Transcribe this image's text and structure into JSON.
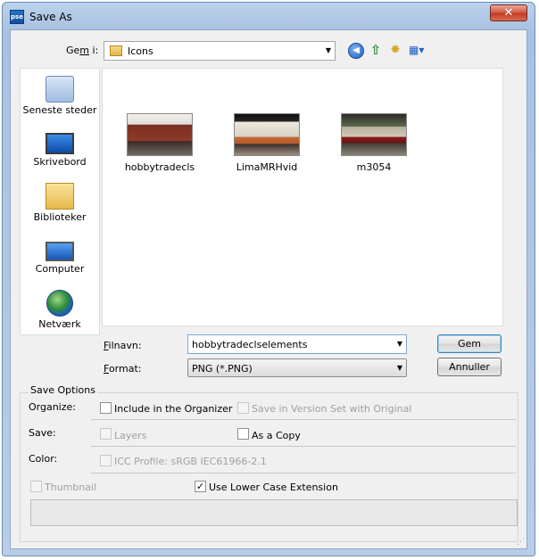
{
  "window": {
    "title": "Save As",
    "app_icon_text": "pse",
    "close_glyph": "✕"
  },
  "lookin": {
    "label_before": "Ge",
    "label_underline": "m",
    "label_after": " i:",
    "value": "Icons",
    "arrow": "▼"
  },
  "toolbar": {
    "back_glyph": "◀",
    "up_glyph": "⇧",
    "new_folder_glyph": "✸",
    "views_glyph": "▦▾"
  },
  "places": [
    {
      "label": "Seneste steder",
      "icon": "recent-places-icon"
    },
    {
      "label": "Skrivebord",
      "icon": "desktop-icon"
    },
    {
      "label": "Biblioteker",
      "icon": "libraries-icon"
    },
    {
      "label": "Computer",
      "icon": "computer-icon"
    },
    {
      "label": "Netværk",
      "icon": "network-icon"
    }
  ],
  "files": [
    {
      "name": "hobbytradecls"
    },
    {
      "name": "LimaMRHvid"
    },
    {
      "name": "m3054"
    }
  ],
  "filename": {
    "label_underline": "F",
    "label_rest": "ilnavn:",
    "value": "hobbytradeclselements",
    "arrow": "▼"
  },
  "format": {
    "label_underline": "F",
    "label_rest": "ormat:",
    "value": "PNG (*.PNG)",
    "arrow": "▼"
  },
  "buttons": {
    "save": "Gem",
    "cancel": "Annuller"
  },
  "options": {
    "title": "Save Options",
    "organize_label": "Organize:",
    "include_organizer": {
      "label": "Include in the Organizer",
      "checked": false
    },
    "save_version_set": {
      "label": "Save in Version Set with Original",
      "checked": false,
      "disabled": true
    },
    "save_label": "Save:",
    "layers": {
      "label": "Layers",
      "checked": false,
      "disabled": true
    },
    "as_copy": {
      "label": "As a Copy",
      "checked": false
    },
    "color_label": "Color:",
    "icc": {
      "label": "ICC Profile:  sRGB IEC61966-2.1",
      "checked": false,
      "disabled": true
    },
    "thumbnail": {
      "label": "Thumbnail",
      "checked": false,
      "disabled": true
    },
    "lowercase": {
      "label": "Use Lower Case Extension",
      "checked": true,
      "check_glyph": "✓"
    }
  },
  "colors": {
    "title_bar": "#b8cde6",
    "close_red": "#c23a20",
    "accent_blue": "#3c7fb1"
  }
}
